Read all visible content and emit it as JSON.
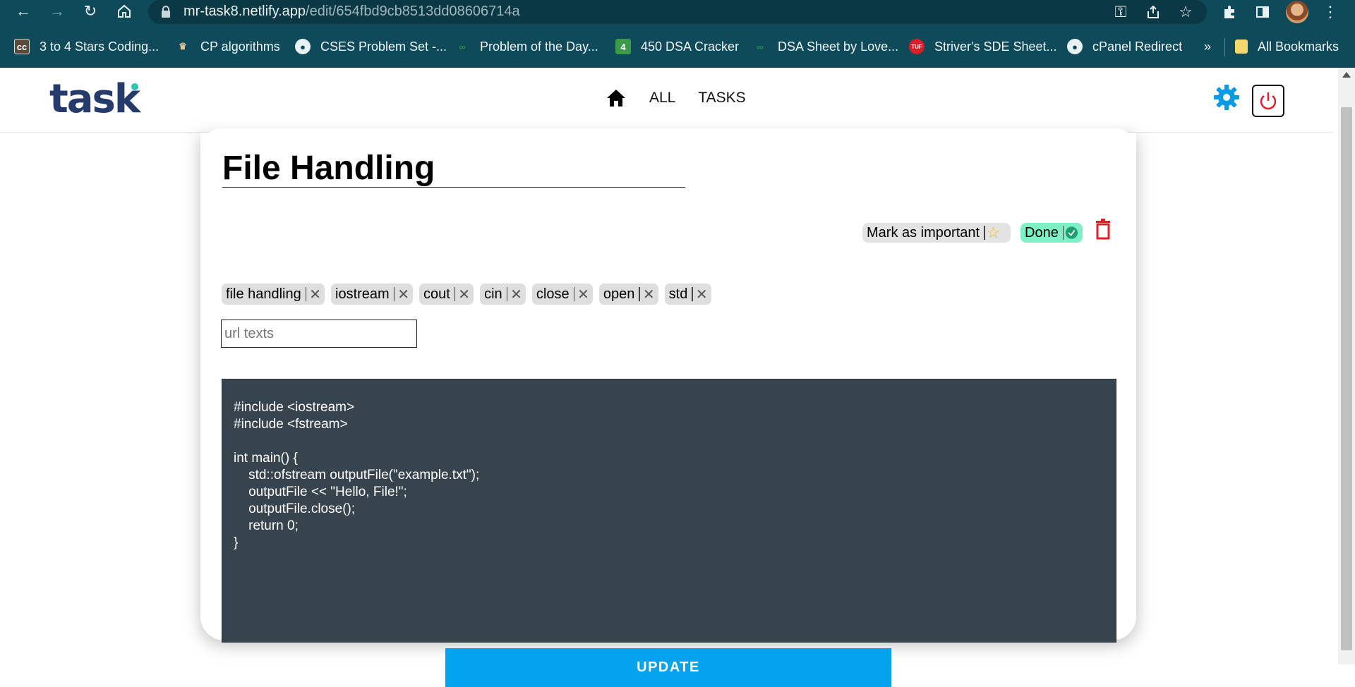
{
  "browser": {
    "url_domain": "mr-task8.netlify.app",
    "url_path": "/edit/654fbd9cb8513dd08606714a",
    "bookmarks": [
      {
        "label": "3 to 4 Stars Coding...",
        "icon": "cc-icon"
      },
      {
        "label": "CP algorithms",
        "icon": "cp-algorithms-icon"
      },
      {
        "label": "CSES Problem Set -...",
        "icon": "globe-icon"
      },
      {
        "label": "Problem of the Day...",
        "icon": "gfg-icon"
      },
      {
        "label": "450 DSA Cracker",
        "icon": "four-icon"
      },
      {
        "label": "DSA Sheet by Love...",
        "icon": "gfg-icon"
      },
      {
        "label": "Striver's SDE Sheet...",
        "icon": "tuf-icon"
      },
      {
        "label": "cPanel Redirect",
        "icon": "globe-icon"
      }
    ],
    "more_bookmarks": "»",
    "all_bookmarks": "All Bookmarks"
  },
  "app": {
    "logo": "task",
    "nav": {
      "all": "ALL",
      "tasks": "TASKS"
    }
  },
  "task": {
    "title": "File Handling",
    "important_label": "Mark as important",
    "done_label": "Done",
    "tags": [
      "file handling",
      "iostream",
      "cout",
      "cin",
      "close",
      "open",
      "std"
    ],
    "url_placeholder": "url texts",
    "code": "#include <iostream>\n#include <fstream>\n\nint main() {\n    std::ofstream outputFile(\"example.txt\");\n    outputFile << \"Hello, File!\";\n    outputFile.close();\n    return 0;\n}",
    "update_label": "UPDATE"
  },
  "colors": {
    "chrome": "#0e4a5a",
    "accent": "#03a3ed",
    "done_bg": "#7ef0c6",
    "danger": "#e0212b",
    "code_bg": "#37444e"
  }
}
